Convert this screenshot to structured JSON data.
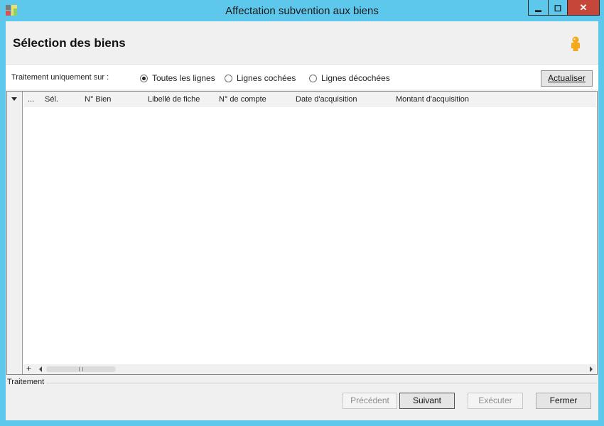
{
  "window": {
    "title": "Affectation subvention aux biens",
    "accent_color": "#5ec8ec",
    "close_color": "#c7463a"
  },
  "controls": {
    "minimize": "▬",
    "maximize": "◻",
    "close": "✕"
  },
  "header": {
    "title": "Sélection des biens",
    "icon": "person-icon"
  },
  "filter": {
    "label": "Traitement uniquement sur :",
    "options": [
      {
        "label": "Toutes les lignes",
        "selected": true
      },
      {
        "label": "Lignes cochées",
        "selected": false
      },
      {
        "label": "Lignes décochées",
        "selected": false
      }
    ],
    "refresh_label": "Actualiser"
  },
  "grid": {
    "columns": [
      "...",
      "Sél.",
      "N° Bien",
      "Libellé de fiche",
      "N° de compte",
      "Date d'acquisition",
      "Montant d'acquisition"
    ],
    "rows": [],
    "add_row": "+"
  },
  "group": {
    "label": "Traitement"
  },
  "buttons": {
    "previous": "Précédent",
    "next": "Suivant",
    "execute": "Exécuter",
    "close": "Fermer"
  }
}
